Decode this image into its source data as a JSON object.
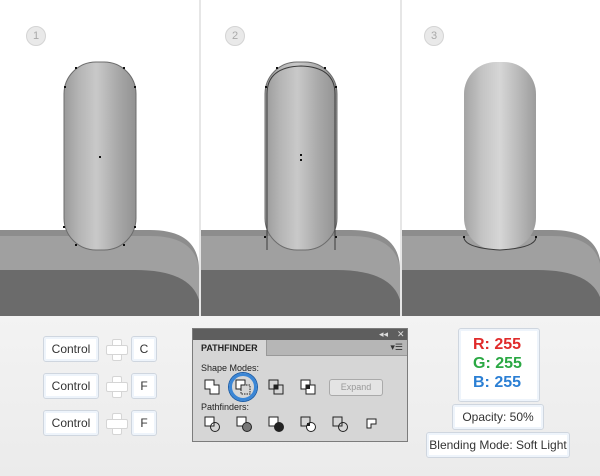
{
  "steps": [
    "1",
    "2",
    "3"
  ],
  "shortcuts": [
    {
      "modifier": "Control",
      "key": "C"
    },
    {
      "modifier": "Control",
      "key": "F"
    },
    {
      "modifier": "Control",
      "key": "F"
    }
  ],
  "pathfinder": {
    "tab": "PATHFINDER",
    "shape_modes_label": "Shape Modes:",
    "pathfinders_label": "Pathfinders:",
    "expand_label": "Expand",
    "collapse_glyph": "◂◂",
    "close_glyph": "✕",
    "menu_glyph": "▾☰",
    "shape_mode_icons": [
      "unite-icon",
      "minus-front-icon",
      "intersect-icon",
      "exclude-icon"
    ],
    "pathfinder_icons": [
      "divide-icon",
      "trim-icon",
      "merge-icon",
      "crop-icon",
      "outline-icon",
      "minus-back-icon"
    ],
    "highlighted_icon": "minus-front-icon"
  },
  "color": {
    "r_label": "R: 255",
    "g_label": "G: 255",
    "b_label": "B: 255",
    "r_color": "#e02b2b",
    "g_color": "#2aa843",
    "b_color": "#2b7fd4"
  },
  "opacity_label": "Opacity: 50%",
  "blending_label": "Blending Mode: Soft Light"
}
